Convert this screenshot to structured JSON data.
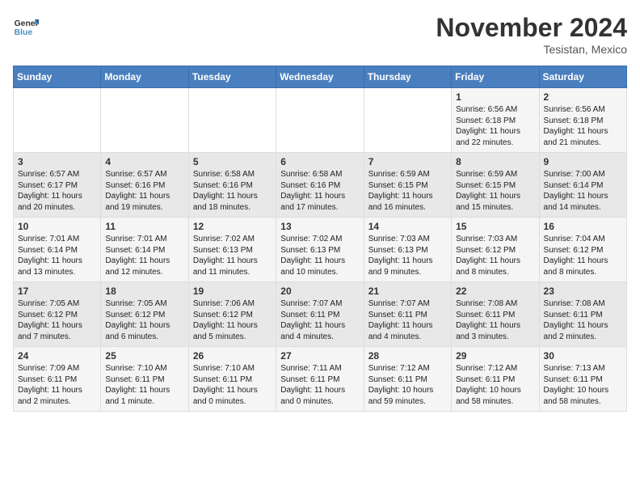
{
  "logo": {
    "line1": "General",
    "line2": "Blue"
  },
  "title": "November 2024",
  "location": "Tesistan, Mexico",
  "days_of_week": [
    "Sunday",
    "Monday",
    "Tuesday",
    "Wednesday",
    "Thursday",
    "Friday",
    "Saturday"
  ],
  "weeks": [
    [
      {
        "day": "",
        "info": ""
      },
      {
        "day": "",
        "info": ""
      },
      {
        "day": "",
        "info": ""
      },
      {
        "day": "",
        "info": ""
      },
      {
        "day": "",
        "info": ""
      },
      {
        "day": "1",
        "info": "Sunrise: 6:56 AM\nSunset: 6:18 PM\nDaylight: 11 hours\nand 22 minutes."
      },
      {
        "day": "2",
        "info": "Sunrise: 6:56 AM\nSunset: 6:18 PM\nDaylight: 11 hours\nand 21 minutes."
      }
    ],
    [
      {
        "day": "3",
        "info": "Sunrise: 6:57 AM\nSunset: 6:17 PM\nDaylight: 11 hours\nand 20 minutes."
      },
      {
        "day": "4",
        "info": "Sunrise: 6:57 AM\nSunset: 6:16 PM\nDaylight: 11 hours\nand 19 minutes."
      },
      {
        "day": "5",
        "info": "Sunrise: 6:58 AM\nSunset: 6:16 PM\nDaylight: 11 hours\nand 18 minutes."
      },
      {
        "day": "6",
        "info": "Sunrise: 6:58 AM\nSunset: 6:16 PM\nDaylight: 11 hours\nand 17 minutes."
      },
      {
        "day": "7",
        "info": "Sunrise: 6:59 AM\nSunset: 6:15 PM\nDaylight: 11 hours\nand 16 minutes."
      },
      {
        "day": "8",
        "info": "Sunrise: 6:59 AM\nSunset: 6:15 PM\nDaylight: 11 hours\nand 15 minutes."
      },
      {
        "day": "9",
        "info": "Sunrise: 7:00 AM\nSunset: 6:14 PM\nDaylight: 11 hours\nand 14 minutes."
      }
    ],
    [
      {
        "day": "10",
        "info": "Sunrise: 7:01 AM\nSunset: 6:14 PM\nDaylight: 11 hours\nand 13 minutes."
      },
      {
        "day": "11",
        "info": "Sunrise: 7:01 AM\nSunset: 6:14 PM\nDaylight: 11 hours\nand 12 minutes."
      },
      {
        "day": "12",
        "info": "Sunrise: 7:02 AM\nSunset: 6:13 PM\nDaylight: 11 hours\nand 11 minutes."
      },
      {
        "day": "13",
        "info": "Sunrise: 7:02 AM\nSunset: 6:13 PM\nDaylight: 11 hours\nand 10 minutes."
      },
      {
        "day": "14",
        "info": "Sunrise: 7:03 AM\nSunset: 6:13 PM\nDaylight: 11 hours\nand 9 minutes."
      },
      {
        "day": "15",
        "info": "Sunrise: 7:03 AM\nSunset: 6:12 PM\nDaylight: 11 hours\nand 8 minutes."
      },
      {
        "day": "16",
        "info": "Sunrise: 7:04 AM\nSunset: 6:12 PM\nDaylight: 11 hours\nand 8 minutes."
      }
    ],
    [
      {
        "day": "17",
        "info": "Sunrise: 7:05 AM\nSunset: 6:12 PM\nDaylight: 11 hours\nand 7 minutes."
      },
      {
        "day": "18",
        "info": "Sunrise: 7:05 AM\nSunset: 6:12 PM\nDaylight: 11 hours\nand 6 minutes."
      },
      {
        "day": "19",
        "info": "Sunrise: 7:06 AM\nSunset: 6:12 PM\nDaylight: 11 hours\nand 5 minutes."
      },
      {
        "day": "20",
        "info": "Sunrise: 7:07 AM\nSunset: 6:11 PM\nDaylight: 11 hours\nand 4 minutes."
      },
      {
        "day": "21",
        "info": "Sunrise: 7:07 AM\nSunset: 6:11 PM\nDaylight: 11 hours\nand 4 minutes."
      },
      {
        "day": "22",
        "info": "Sunrise: 7:08 AM\nSunset: 6:11 PM\nDaylight: 11 hours\nand 3 minutes."
      },
      {
        "day": "23",
        "info": "Sunrise: 7:08 AM\nSunset: 6:11 PM\nDaylight: 11 hours\nand 2 minutes."
      }
    ],
    [
      {
        "day": "24",
        "info": "Sunrise: 7:09 AM\nSunset: 6:11 PM\nDaylight: 11 hours\nand 2 minutes."
      },
      {
        "day": "25",
        "info": "Sunrise: 7:10 AM\nSunset: 6:11 PM\nDaylight: 11 hours\nand 1 minute."
      },
      {
        "day": "26",
        "info": "Sunrise: 7:10 AM\nSunset: 6:11 PM\nDaylight: 11 hours\nand 0 minutes."
      },
      {
        "day": "27",
        "info": "Sunrise: 7:11 AM\nSunset: 6:11 PM\nDaylight: 11 hours\nand 0 minutes."
      },
      {
        "day": "28",
        "info": "Sunrise: 7:12 AM\nSunset: 6:11 PM\nDaylight: 10 hours\nand 59 minutes."
      },
      {
        "day": "29",
        "info": "Sunrise: 7:12 AM\nSunset: 6:11 PM\nDaylight: 10 hours\nand 58 minutes."
      },
      {
        "day": "30",
        "info": "Sunrise: 7:13 AM\nSunset: 6:11 PM\nDaylight: 10 hours\nand 58 minutes."
      }
    ]
  ]
}
